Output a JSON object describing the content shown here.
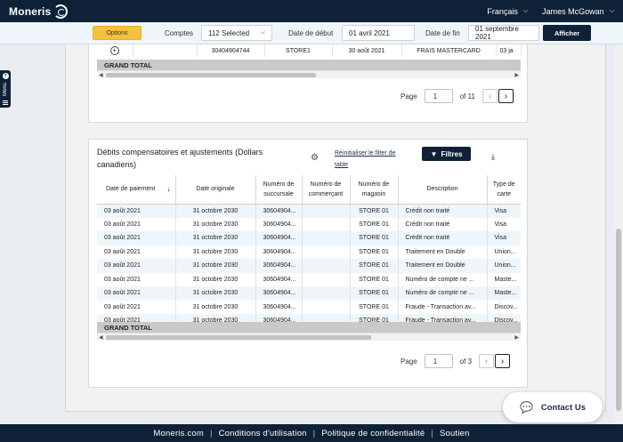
{
  "header": {
    "brand": "Moneris",
    "language": "Français",
    "user": "James McGowan"
  },
  "filters": {
    "options_label": "Options",
    "comptes_label": "Comptes",
    "comptes_value": "112 Selected",
    "date_debut_label": "Date de début",
    "date_debut_value": "01 avril 2021",
    "date_fin_label": "Date de fin",
    "date_fin_value": "01 septembre 2021",
    "afficher_label": "Afficher"
  },
  "sidemenu": {
    "help": "?",
    "label": "Menu"
  },
  "card1": {
    "row": {
      "col1": "30404904744",
      "col2": "STORE1",
      "col3": "30 août 2021",
      "col4": "FRAIS MASTERCARD",
      "col5": "03 ja"
    },
    "grand_total": "GRAND TOTAL",
    "pager": {
      "page_label": "Page",
      "page_value": "1",
      "of_label": "of 11",
      "prev": "‹",
      "next": "›"
    }
  },
  "card2": {
    "title": "Débits compensatoires et ajustements (Dollars canadiens)",
    "reset_link": "Réinitialiser le filter de table",
    "filtres_label": "Filtres",
    "columns": [
      "Date de paiement",
      "Date originale",
      "Numéro de succursale",
      "Numéro de commerçant",
      "Numéro de magasin",
      "Description",
      "Type de carte"
    ],
    "sort_indicator": "↓",
    "rows": [
      [
        "03 août 2021",
        "31 octobre 2030",
        "30604904...",
        "",
        "STORE 01",
        "Crédit non traité",
        "Visa"
      ],
      [
        "03 août 2021",
        "31 octobre 2030",
        "30604904...",
        "",
        "STORE 01",
        "Crédit non traité",
        "Visa"
      ],
      [
        "03 août 2021",
        "31 octobre 2030",
        "30604904...",
        "",
        "STORE 01",
        "Crédit non traité",
        "Visa"
      ],
      [
        "03 août 2021",
        "31 octobre 2030",
        "30604904...",
        "",
        "STORE 01",
        "Traitement en Double",
        "Union..."
      ],
      [
        "03 août 2021",
        "31 octobre 2030",
        "30604904...",
        "",
        "STORE 01",
        "Traitement en Double",
        "Union..."
      ],
      [
        "03 août 2021",
        "31 octobre 2030",
        "30604904...",
        "",
        "STORE 01",
        "Numéro de compte ne ...",
        "Maste..."
      ],
      [
        "03 août 2021",
        "31 octobre 2030",
        "30604904...",
        "",
        "STORE 01",
        "Numéro de compte ne ...",
        "Maste..."
      ],
      [
        "03 août 2021",
        "31 octobre 2030",
        "30604904...",
        "",
        "STORE 01",
        "Fraude - Transaction av...",
        "Discov..."
      ],
      [
        "03 août 2021",
        "31 octobre 2030",
        "30604904...",
        "",
        "STORE 01",
        "Fraude - Transaction av...",
        "Discov..."
      ]
    ],
    "grand_total": "GRAND TOTAL",
    "pager": {
      "page_label": "Page",
      "page_value": "1",
      "of_label": "of 3",
      "prev": "‹",
      "next": "›"
    }
  },
  "footer": {
    "links": [
      "Moneris.com",
      "Conditions d'utilisation",
      "Politique de confidentialité",
      "Soutien"
    ],
    "separator": "|"
  },
  "contact": {
    "label": "Contact Us"
  },
  "colors": {
    "navy": "#0f2137",
    "options_yellow": "#f6c23e",
    "row_alt": "#eef6fb"
  }
}
